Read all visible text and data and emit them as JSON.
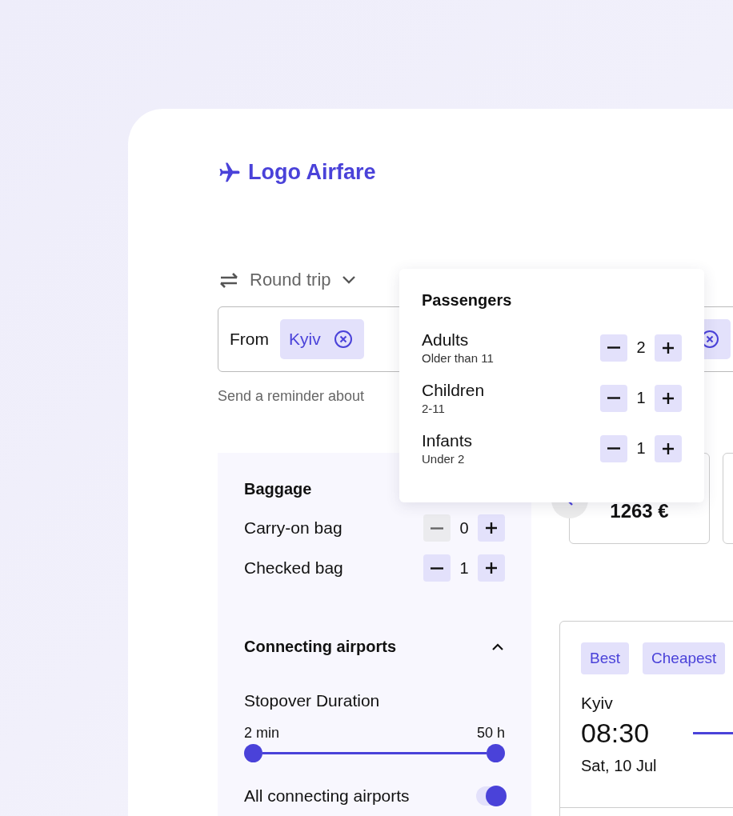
{
  "logo": {
    "text": "Logo Airfare"
  },
  "trip_type": {
    "label": "Round trip"
  },
  "from_field": {
    "label": "From",
    "chips": [
      {
        "kind": "chip",
        "text": "Kyiv"
      },
      {
        "kind": "covered"
      }
    ]
  },
  "reminder": {
    "text": "Send a reminder about"
  },
  "baggage": {
    "title": "Baggage",
    "rows": [
      {
        "label": "Carry-on bag",
        "value": "0",
        "minus_disabled": true
      },
      {
        "label": "Checked bag",
        "value": "1",
        "minus_disabled": false
      }
    ]
  },
  "connecting_airports": {
    "title": "Connecting airports",
    "expanded": true,
    "stopover": {
      "label": "Stopover Duration",
      "min_label": "2 min",
      "max_label": "50 h",
      "thumbs": [
        {
          "level": 0
        },
        {
          "level": 1
        }
      ]
    },
    "all_airports": {
      "label": "All connecting airports",
      "on": true
    }
  },
  "price_cards": [
    {
      "kind": "price",
      "price": "1263 €"
    },
    {
      "kind": "edge"
    }
  ],
  "result": {
    "tags": [
      {
        "label": "Best"
      },
      {
        "label": "Cheapest"
      }
    ],
    "city": "Kyiv",
    "time": "08:30",
    "date": "Sat, 10 Jul"
  },
  "passengers": {
    "title": "Passengers",
    "rows": [
      {
        "label": "Adults",
        "hint": "Older than 11",
        "value": "2"
      },
      {
        "label": "Children",
        "hint": "2-11",
        "value": "1"
      },
      {
        "label": "Infants",
        "hint": "Under 2",
        "value": "1"
      }
    ]
  }
}
